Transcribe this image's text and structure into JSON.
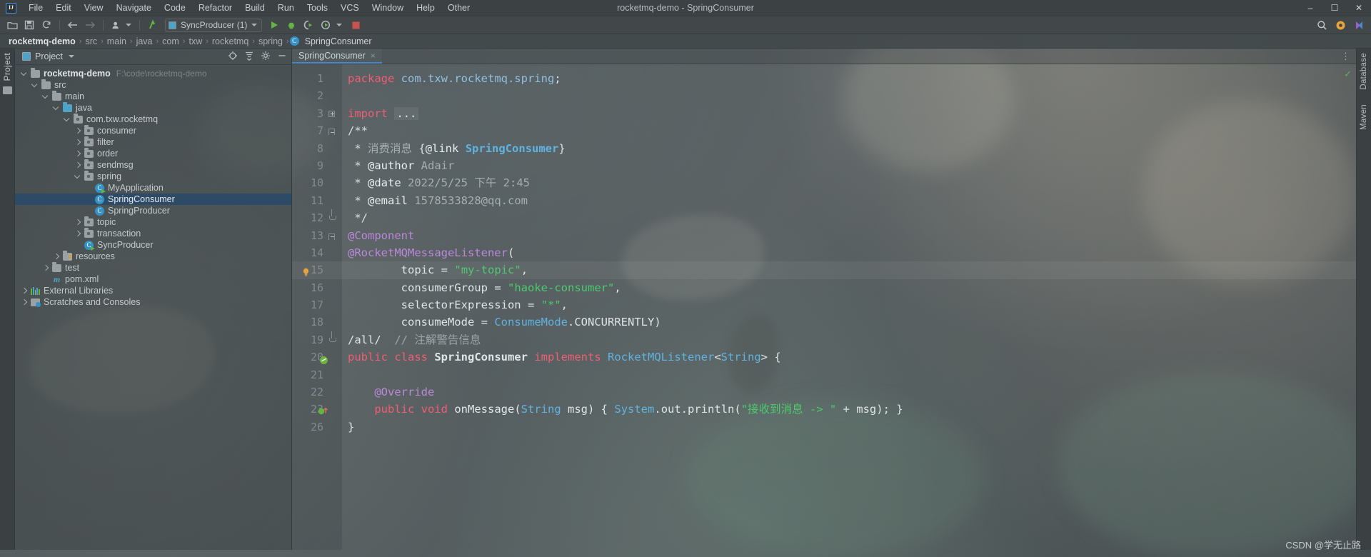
{
  "window": {
    "title": "rocketmq-demo - SpringConsumer"
  },
  "menu": {
    "logo": "ij-logo",
    "items": [
      "File",
      "Edit",
      "View",
      "Navigate",
      "Code",
      "Refactor",
      "Build",
      "Run",
      "Tools",
      "VCS",
      "Window",
      "Help",
      "Other"
    ],
    "controls": [
      "minimize",
      "maximize",
      "close"
    ]
  },
  "toolbar": {
    "icons": [
      "open-folder-icon",
      "save-all-icon",
      "sync-icon",
      "back-arrow-icon",
      "forward-arrow-icon",
      "profile-icon",
      "update-project-icon"
    ],
    "run_config": "SyncProducer (1)",
    "run_label": "run-icon",
    "debug_label": "debug-icon",
    "coverage_label": "coverage-icon",
    "profile_label": "profiler-icon",
    "stop_label": "stop-icon",
    "right_icons": [
      "search-everywhere-icon",
      "settings-icon",
      "account-icon"
    ]
  },
  "breadcrumb": {
    "items": [
      "rocketmq-demo",
      "src",
      "main",
      "java",
      "com",
      "txw",
      "rocketmq",
      "spring",
      "SpringConsumer"
    ],
    "separator": "›",
    "last_icon": "C"
  },
  "left_strip": {
    "label": "Project"
  },
  "right_strip": {
    "labels": [
      "Database",
      "Maven"
    ]
  },
  "project_panel": {
    "title": "Project",
    "dropdown": "chevron-down-icon",
    "actions": [
      "locate-icon",
      "collapse-all-icon",
      "settings-icon",
      "hide-icon"
    ],
    "tree": [
      {
        "label": "rocketmq-demo",
        "path": "F:\\code\\rocketmq-demo",
        "indent": 0,
        "arrow": "down",
        "icon": "module-folder",
        "bold": true
      },
      {
        "label": "src",
        "indent": 1,
        "arrow": "down",
        "icon": "folder"
      },
      {
        "label": "main",
        "indent": 2,
        "arrow": "down",
        "icon": "folder"
      },
      {
        "label": "java",
        "indent": 3,
        "arrow": "down",
        "icon": "source-folder"
      },
      {
        "label": "com.txw.rocketmq",
        "indent": 4,
        "arrow": "down",
        "icon": "package"
      },
      {
        "label": "consumer",
        "indent": 5,
        "arrow": "right",
        "icon": "package"
      },
      {
        "label": "filter",
        "indent": 5,
        "arrow": "right",
        "icon": "package"
      },
      {
        "label": "order",
        "indent": 5,
        "arrow": "right",
        "icon": "package"
      },
      {
        "label": "sendmsg",
        "indent": 5,
        "arrow": "right",
        "icon": "package"
      },
      {
        "label": "spring",
        "indent": 5,
        "arrow": "down",
        "icon": "package"
      },
      {
        "label": "MyApplication",
        "indent": 6,
        "arrow": "none",
        "icon": "runnable-class"
      },
      {
        "label": "SpringConsumer",
        "indent": 6,
        "arrow": "none",
        "icon": "class",
        "selected": true
      },
      {
        "label": "SpringProducer",
        "indent": 6,
        "arrow": "none",
        "icon": "class"
      },
      {
        "label": "topic",
        "indent": 5,
        "arrow": "right",
        "icon": "package"
      },
      {
        "label": "transaction",
        "indent": 5,
        "arrow": "right",
        "icon": "package"
      },
      {
        "label": "SyncProducer",
        "indent": 5,
        "arrow": "none",
        "icon": "runnable-class"
      },
      {
        "label": "resources",
        "indent": 3,
        "arrow": "right",
        "icon": "resources-folder"
      },
      {
        "label": "test",
        "indent": 2,
        "arrow": "right",
        "icon": "folder"
      },
      {
        "label": "pom.xml",
        "indent": 2,
        "arrow": "none",
        "icon": "maven"
      },
      {
        "label": "External Libraries",
        "indent": 0,
        "arrow": "right",
        "icon": "libraries"
      },
      {
        "label": "Scratches and Consoles",
        "indent": 0,
        "arrow": "right",
        "icon": "scratches"
      }
    ]
  },
  "editor": {
    "tab": {
      "label": "SpringConsumer",
      "close": "×"
    },
    "inspection_status": "✓",
    "lines": [
      {
        "num": "1",
        "fold": "none"
      },
      {
        "num": "2",
        "fold": "none"
      },
      {
        "num": "3",
        "fold": "plus"
      },
      {
        "num": "7",
        "fold": "top"
      },
      {
        "num": "8",
        "fold": "none"
      },
      {
        "num": "9",
        "fold": "none"
      },
      {
        "num": "10",
        "fold": "none"
      },
      {
        "num": "11",
        "fold": "none"
      },
      {
        "num": "12",
        "fold": "end"
      },
      {
        "num": "13",
        "fold": "top"
      },
      {
        "num": "14",
        "fold": "none"
      },
      {
        "num": "15",
        "fold": "none",
        "highlight": true,
        "bulb": true
      },
      {
        "num": "16",
        "fold": "none"
      },
      {
        "num": "17",
        "fold": "none"
      },
      {
        "num": "18",
        "fold": "none"
      },
      {
        "num": "19",
        "fold": "end"
      },
      {
        "num": "20",
        "fold": "none",
        "marker": "spring-bean"
      },
      {
        "num": "21",
        "fold": "none"
      },
      {
        "num": "22",
        "fold": "none"
      },
      {
        "num": "23",
        "fold": "none",
        "marker": "override-impl"
      },
      {
        "num": "26",
        "fold": "none"
      }
    ],
    "code_text": [
      "package com.txw.rocketmq.spring;",
      "",
      "import ...",
      "/**",
      " * 消费消息 {@link SpringConsumer}",
      " * @author Adair",
      " * @date 2022/5/25 下午 2:45",
      " * @email 1578533828@qq.com",
      " */",
      "@Component",
      "@RocketMQMessageListener(",
      "        topic = \"my-topic\",",
      "        consumerGroup = \"haoke-consumer\",",
      "        selectorExpression = \"*\",",
      "        consumeMode = ConsumeMode.CONCURRENTLY)",
      "/all/  // 注解警告信息",
      "public class SpringConsumer implements RocketMQListener<String> {",
      "",
      "    @Override",
      "    public void onMessage(String msg) { System.out.println(\"接收到消息 -> \" + msg); }",
      "}"
    ]
  },
  "watermark": {
    "text": "CSDN @学无止路"
  },
  "colors": {
    "accent": "#4a88c7",
    "selection": "#2d4a66",
    "keyword": "#cc7832",
    "string": "#4ec96f",
    "annotation": "#bb88d9",
    "type": "#5fb3e0",
    "comment": "#9aa4a8",
    "run_green": "#62b543",
    "stop_red": "#c75450"
  }
}
